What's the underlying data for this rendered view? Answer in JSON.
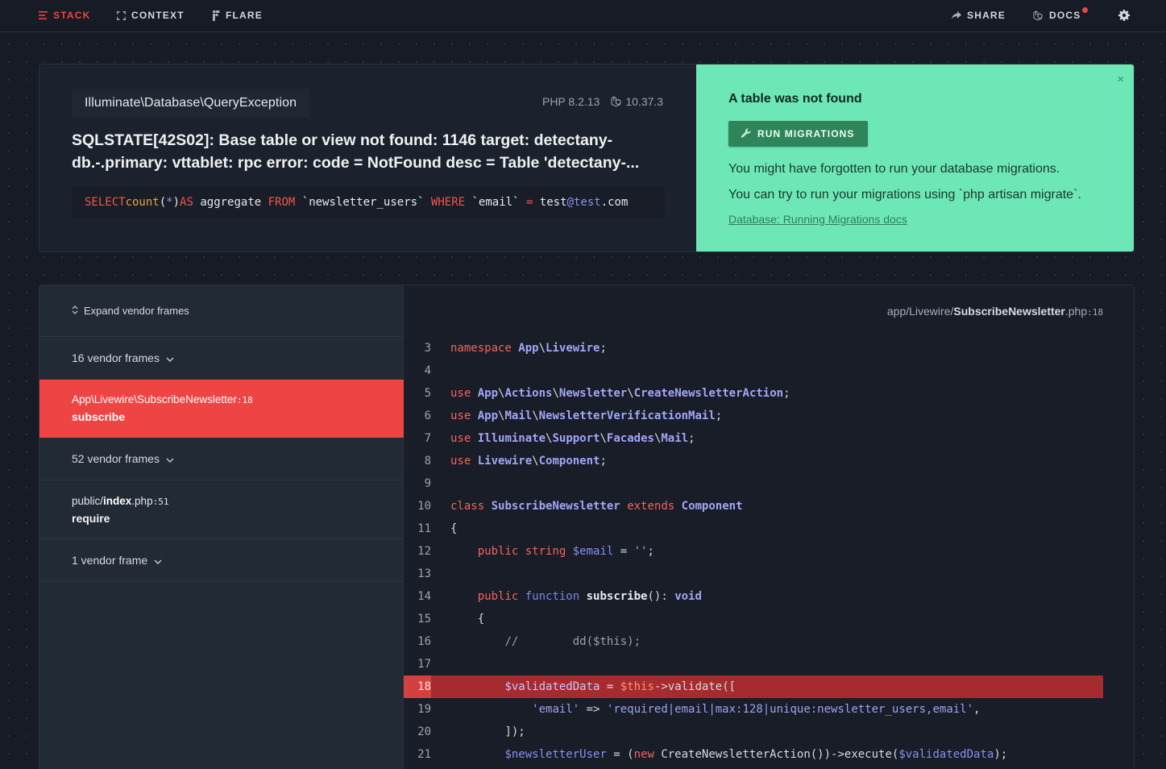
{
  "nav": {
    "stack": "STACK",
    "context": "CONTEXT",
    "flare": "FLARE",
    "share": "SHARE",
    "docs": "DOCS"
  },
  "error": {
    "exception_class": "Illuminate\\Database\\QueryException",
    "php_version": "PHP 8.2.13",
    "laravel_version": "10.37.3",
    "message": "SQLSTATE[42S02]: Base table or view not found: 1146 target: detectany-db.-.primary: vttablet: rpc error: code = NotFound desc = Table 'detectany-...",
    "sql": {
      "select": "SELECT",
      "count": "count",
      "count_open": "(",
      "star": "*",
      "count_close": ")",
      "as": "AS",
      "aggregate": " aggregate ",
      "from": "FROM",
      "table": " `newsletter_users` ",
      "where": "WHERE",
      "column": " `email` ",
      "eq": "=",
      "val_a": " test",
      "val_at": "@test",
      "val_b": ".com"
    }
  },
  "solution": {
    "title": "A table was not found",
    "button": "RUN MIGRATIONS",
    "line1": "You might have forgotten to run your database migrations.",
    "line2": "You can try to run your migrations using `php artisan migrate`.",
    "link": "Database: Running Migrations docs",
    "close": "×"
  },
  "frames": {
    "expand_label": "Expand vendor frames",
    "items": [
      {
        "kind": "vendor",
        "label": "16 vendor frames"
      },
      {
        "kind": "app",
        "path_pre": "App\\Livewire\\",
        "path_file": "SubscribeNewsletter",
        "line": ":18",
        "function": "subscribe",
        "selected": true
      },
      {
        "kind": "vendor",
        "label": "52 vendor frames"
      },
      {
        "kind": "app",
        "path_pre": "public/",
        "path_file": "index",
        "path_ext": ".php",
        "line": ":51",
        "function": "require"
      },
      {
        "kind": "vendor",
        "label": "1 vendor frame"
      }
    ]
  },
  "code": {
    "file_prefix": "app/Livewire/",
    "file_name": "SubscribeNewsletter",
    "file_ext": ".php",
    "file_line": ":18",
    "highlight_line": 18,
    "lines": [
      {
        "n": "3"
      },
      {
        "n": "4"
      },
      {
        "n": "5"
      },
      {
        "n": "6"
      },
      {
        "n": "7"
      },
      {
        "n": "8"
      },
      {
        "n": "9"
      },
      {
        "n": "10"
      },
      {
        "n": "11"
      },
      {
        "n": "12"
      },
      {
        "n": "13"
      },
      {
        "n": "14"
      },
      {
        "n": "15"
      },
      {
        "n": "16"
      },
      {
        "n": "17"
      },
      {
        "n": "18"
      },
      {
        "n": "19"
      },
      {
        "n": "20"
      },
      {
        "n": "21"
      }
    ],
    "text": {
      "l3_kw": "namespace",
      "l3_a": "App",
      "l3_b": "Livewire",
      "use": "use",
      "l5_a": "App",
      "l5_b": "Actions",
      "l5_c": "Newsletter",
      "l5_d": "CreateNewsletterAction",
      "l6_a": "App",
      "l6_b": "Mail",
      "l6_c": "NewsletterVerificationMail",
      "l7_a": "Illuminate",
      "l7_b": "Support",
      "l7_c": "Facades",
      "l7_d": "Mail",
      "l8_a": "Livewire",
      "l8_b": "Component",
      "l10_kw": "class",
      "l10_name": "SubscribeNewsletter",
      "l10_ext": "extends",
      "l10_parent": "Component",
      "l11": "{",
      "l12_pub": "public",
      "l12_type": "string",
      "l12_var": "$email",
      "l12_rest": " = ",
      "l12_str": "''",
      "l12_end": ";",
      "l14_pub": "public",
      "l14_fn": "function",
      "l14_name": "subscribe",
      "l14_paren": "(): ",
      "l14_type": "void",
      "l15": "{",
      "l16": "//        dd($this);",
      "l18_var": "$validatedData",
      "l18_eq": " = ",
      "l18_this": "$this",
      "l18_rest": "->validate([",
      "l19_key": "'email'",
      "l19_arrow": " => ",
      "l19_val": "'required|email|max:128|unique:newsletter_users,email'",
      "l19_end": ",",
      "l20": "]);",
      "l21_var": "$newsletterUser",
      "l21_eq": " = (",
      "l21_new": "new",
      "l21_cls": " CreateNewsletterAction())->execute(",
      "l21_arg": "$validatedData",
      "l21_end": ");"
    }
  }
}
